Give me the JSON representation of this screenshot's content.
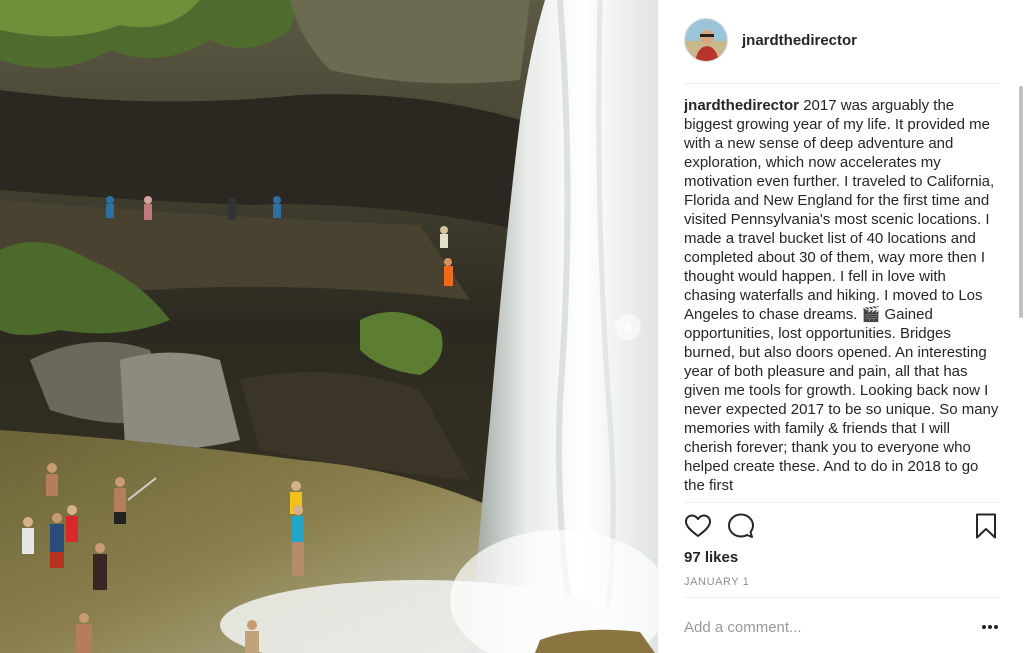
{
  "post": {
    "username": "jnardthedirector",
    "caption_username": "jnardthedirector",
    "caption_text": " 2017 was arguably the biggest growing year of my life. It provided me with a new sense of deep adventure and exploration, which now accelerates my motivation even further. I traveled to California, Florida and New England for the first time and visited Pennsylvania's most scenic locations. I made a travel bucket list of 40 locations and completed about 30 of them, way more then I thought would happen. I fell in love with chasing waterfalls and hiking. I moved to Los Angeles to chase dreams. 🎬 Gained opportunities, lost opportunities. Bridges burned, but also doors opened. An interesting year of both pleasure and pain, all that has given me tools for growth. Looking back now I never expected 2017 to be so unique. So many memories with family & friends that I will cherish forever; thank you to everyone who helped create these. And to do in 2018 to go the first",
    "likes": "97 likes",
    "date": "JANUARY 1"
  },
  "comment_box": {
    "placeholder": "Add a comment..."
  },
  "icons": {
    "like": "heart-icon",
    "comment": "speech-bubble-icon",
    "save": "bookmark-icon",
    "more": "ellipsis-icon",
    "next": "chevron-right-icon"
  },
  "colors": {
    "text": "#262626",
    "muted": "#8e8e8e",
    "divider": "#efefef",
    "placeholder": "#999999"
  }
}
